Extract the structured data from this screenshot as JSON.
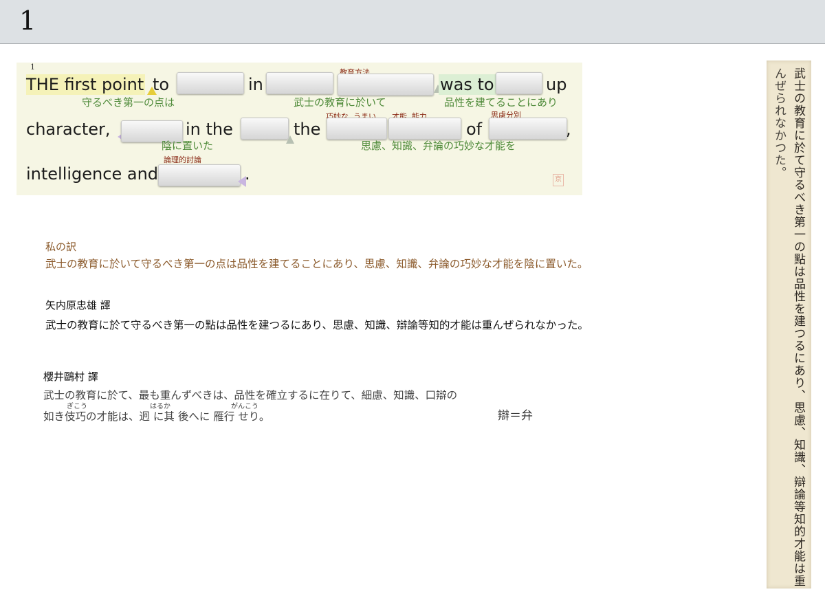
{
  "header": {
    "page_number": "1"
  },
  "card": {
    "line_number": "1",
    "line1": {
      "highlight": "THE first point",
      "w1": "to",
      "w2": "in",
      "w3": "was to",
      "w4": "up"
    },
    "line2": {
      "w1": "character,",
      "w2": "in the",
      "w3": "the",
      "w4": "of",
      "w5": ","
    },
    "line3": {
      "w1": "intelligence and",
      "w2": "."
    },
    "notes": {
      "n1": "教育方法",
      "n2": "巧妙な, うまい",
      "n3": "才能, 能力",
      "n4": "思慮分別",
      "n5": "論理的討論"
    },
    "translations": {
      "t1": "守るべき第一の点は",
      "t2": "武士の教育に於いて",
      "t3": "品性を建てることにあり",
      "t4": "陰に置いた",
      "t5": "思慮、知識、弁論の巧妙な才能を"
    },
    "stamp": "京"
  },
  "my_translation": {
    "label": "私の訳",
    "text": "武士の教育に於いて守るべき第一の点は品性を建てることにあり、思慮、知識、弁論の巧妙な才能を陰に置いた。"
  },
  "yanaihara": {
    "label": "矢内原忠雄 譯",
    "text": "武士の教育に於て守るべき第一の點は品性を建つるにあり、思慮、知識、辯論等知的才能は重んぜられなかった。"
  },
  "sakurai": {
    "label": "櫻井鷗村 譯",
    "line1": "武士の教育に於て、最も重んずべきは、品性を確立するに在りて、細慮、知識、口辯の",
    "line2": "如き伎巧の才能は、迥 に其 後へに 雁行 せり。",
    "ruby1": "ぎこう",
    "ruby2": "はるか",
    "ruby3": "がんこう"
  },
  "note_ben": "辯＝弁",
  "scan": {
    "col1": "武士の教育に於て守るべき第一の點は品性を建つるにあり、思慮、知識、辯論等知的才能は重",
    "col2": "んぜられなかつた。"
  }
}
